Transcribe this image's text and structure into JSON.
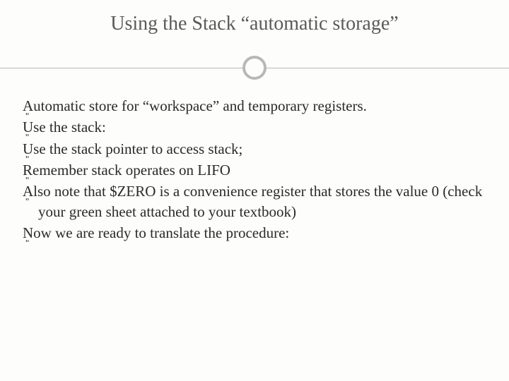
{
  "title": "Using the Stack “automatic storage”",
  "bullets": [
    "Automatic store for “workspace” and temporary registers.",
    "Use the stack:",
    "Use the stack pointer to access stack;",
    "Remember stack operates on LIFO",
    "Also note that $ZERO is a convenience register that stores the value 0 (check your green sheet attached to your textbook)",
    "Now we are ready to translate the procedure:"
  ],
  "bullet_glyph": "ܸ"
}
